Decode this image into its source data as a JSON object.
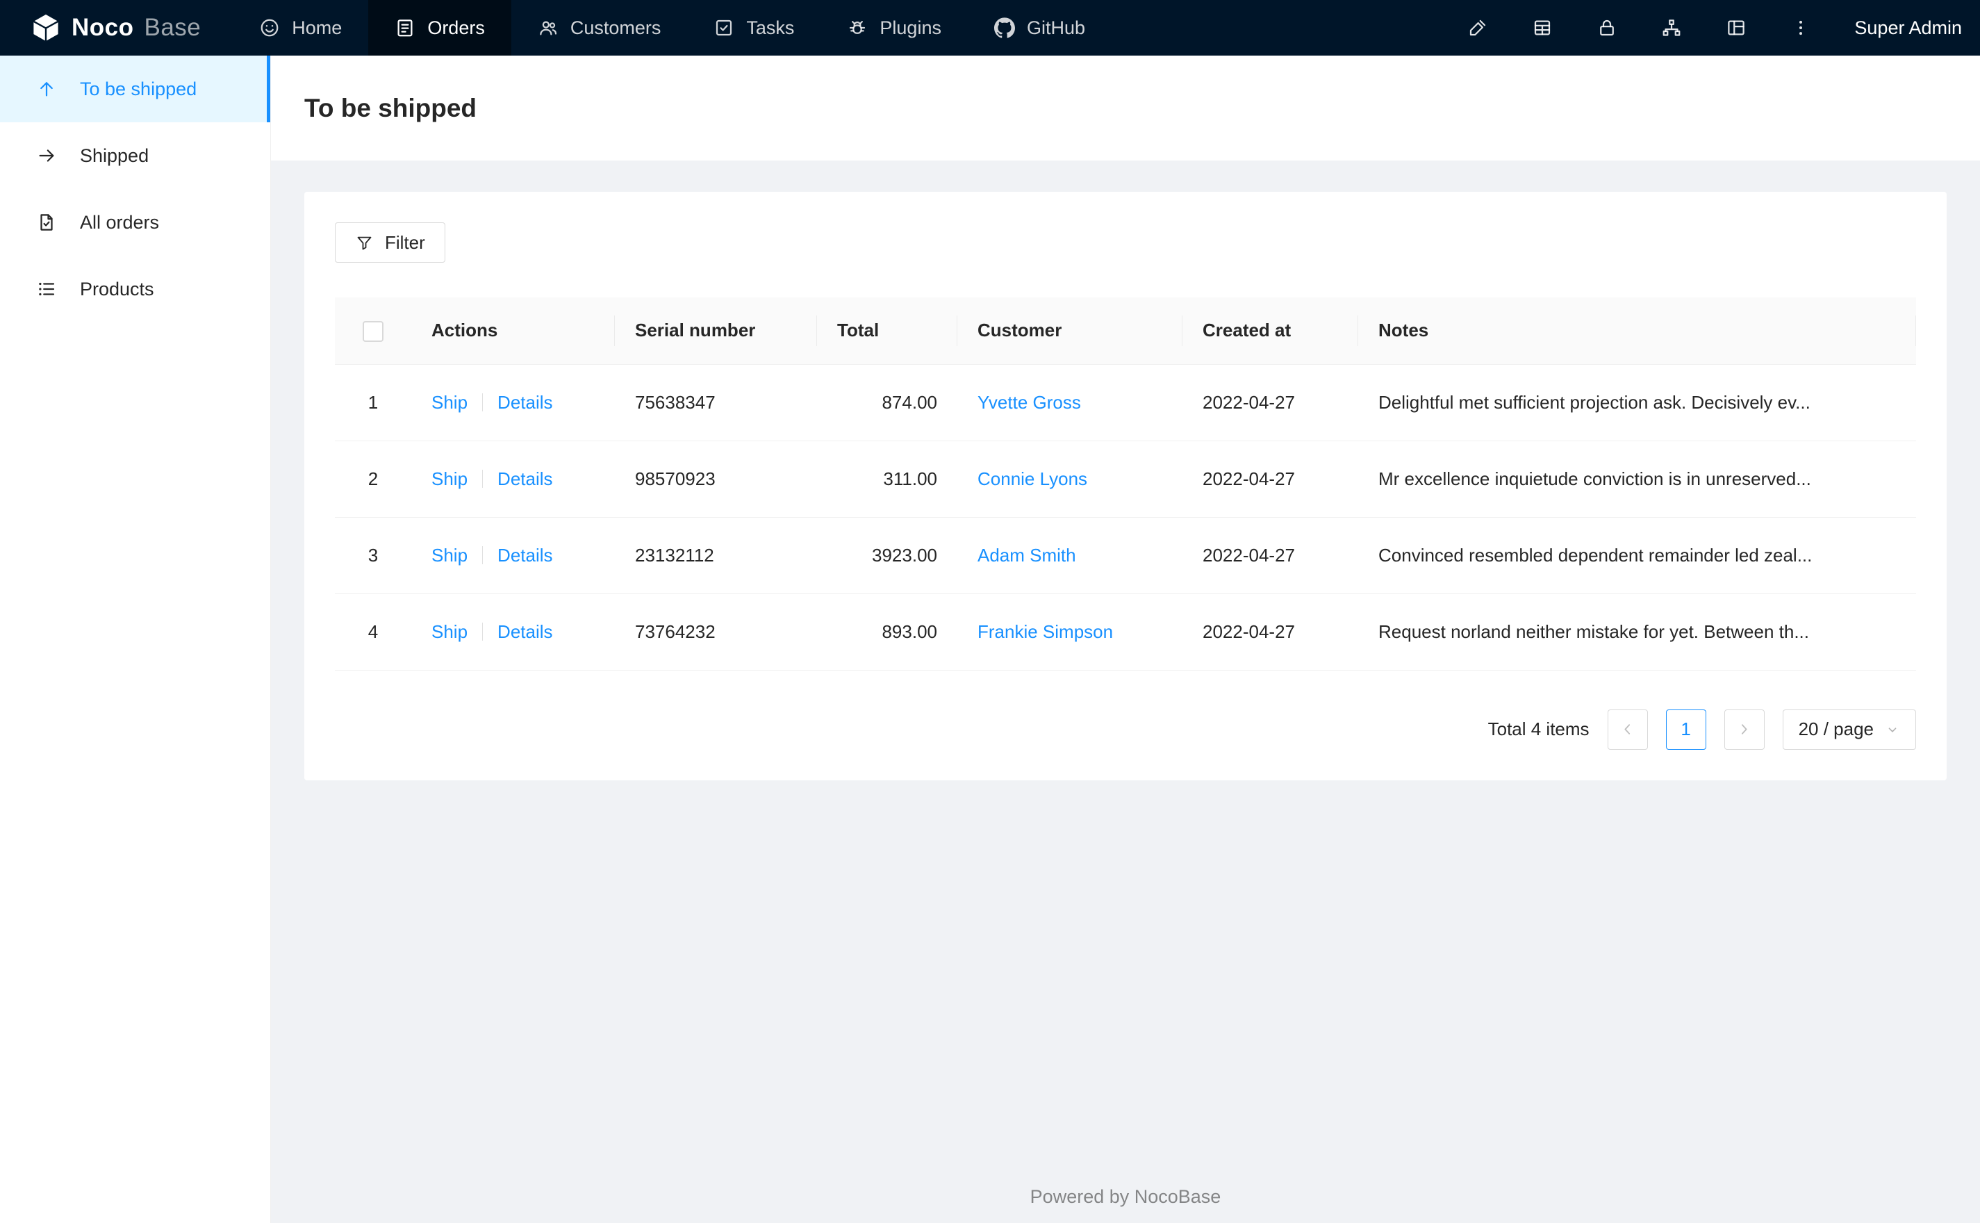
{
  "navbar": {
    "logo_noco": "Noco",
    "logo_base": "Base",
    "items": [
      {
        "label": "Home"
      },
      {
        "label": "Orders",
        "active": true
      },
      {
        "label": "Customers"
      },
      {
        "label": "Tasks"
      },
      {
        "label": "Plugins"
      },
      {
        "label": "GitHub"
      }
    ],
    "user": "Super Admin"
  },
  "sidebar": {
    "items": [
      {
        "label": "To be shipped",
        "active": true
      },
      {
        "label": "Shipped"
      },
      {
        "label": "All orders"
      },
      {
        "label": "Products"
      }
    ]
  },
  "page": {
    "title": "To be shipped"
  },
  "toolbar": {
    "filter_label": "Filter"
  },
  "table": {
    "columns": [
      "Actions",
      "Serial number",
      "Total",
      "Customer",
      "Created at",
      "Notes"
    ],
    "rows": [
      {
        "index": "1",
        "actions": [
          "Ship",
          "Details"
        ],
        "serial": "75638347",
        "total": "874.00",
        "customer": "Yvette Gross",
        "created": "2022-04-27",
        "notes": "Delightful met sufficient projection ask. Decisively ev..."
      },
      {
        "index": "2",
        "actions": [
          "Ship",
          "Details"
        ],
        "serial": "98570923",
        "total": "311.00",
        "customer": "Connie Lyons",
        "created": "2022-04-27",
        "notes": "Mr excellence inquietude conviction is in unreserved..."
      },
      {
        "index": "3",
        "actions": [
          "Ship",
          "Details"
        ],
        "serial": "23132112",
        "total": "3923.00",
        "customer": "Adam Smith",
        "created": "2022-04-27",
        "notes": "Convinced resembled dependent remainder led zeal..."
      },
      {
        "index": "4",
        "actions": [
          "Ship",
          "Details"
        ],
        "serial": "73764232",
        "total": "893.00",
        "customer": "Frankie Simpson",
        "created": "2022-04-27",
        "notes": "Request norland neither mistake for yet. Between th..."
      }
    ]
  },
  "pagination": {
    "total_text": "Total 4 items",
    "current_page": "1",
    "page_size": "20 / page"
  },
  "footer": {
    "text": "Powered by NocoBase"
  },
  "icons": {
    "logo": "nocobase-cube",
    "nav": [
      "home-smiley",
      "orders-clipboard",
      "customers-people",
      "tasks-check-square",
      "plugins-bug",
      "github-mark"
    ],
    "navbar_right": [
      "ui-editor-highlighter",
      "table-grid",
      "lock",
      "org-chart",
      "layout-panel",
      "ellipsis-vertical"
    ],
    "sidebar": [
      "arrow-up",
      "arrow-right",
      "file-check",
      "bullet-list"
    ],
    "filter": "funnel",
    "pagination": [
      "chevron-left",
      "chevron-right",
      "chevron-down"
    ]
  },
  "colors": {
    "accent": "#1890ff",
    "navbar_bg": "#001529",
    "navbar_active_bg": "#000c17",
    "sidebar_active_bg": "#e6f7ff",
    "content_bg": "#f0f2f5",
    "card_bg": "#ffffff",
    "table_header_bg": "#fafafa",
    "border": "#f0f0f0",
    "link": "#1890ff"
  }
}
